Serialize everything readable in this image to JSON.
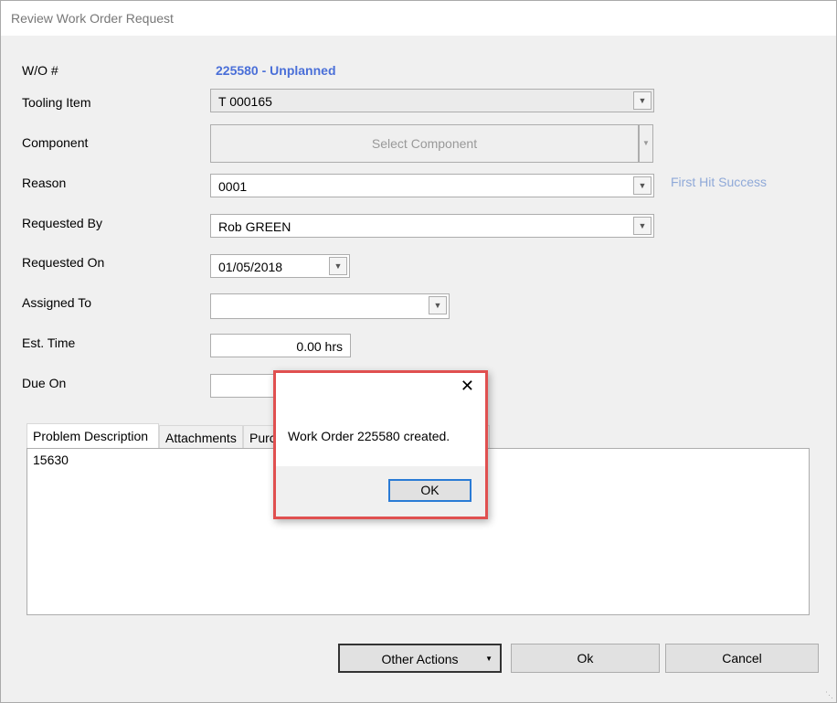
{
  "window": {
    "title": "Review Work Order Request"
  },
  "form": {
    "wo_label": "W/O #",
    "wo_value": "225580 - Unplanned",
    "tooling_label": "Tooling Item",
    "tooling_value": "T 000165",
    "component_label": "Component",
    "component_button": "Select Component",
    "reason_label": "Reason",
    "reason_value": "0001",
    "reason_link": "First Hit Success",
    "requested_by_label": "Requested By",
    "requested_by_value": "Rob GREEN",
    "requested_on_label": "Requested On",
    "requested_on_value": "01/05/2018",
    "assigned_to_label": "Assigned To",
    "assigned_to_value": "",
    "est_time_label": "Est. Time",
    "est_time_value": "0.00 hrs",
    "due_on_label": "Due On",
    "due_on_value": ""
  },
  "tabs": [
    {
      "label": "Problem Description"
    },
    {
      "label": "Attachments"
    },
    {
      "label": "Purc"
    }
  ],
  "problem_description": "15630",
  "buttons": {
    "other_actions": "Other Actions",
    "ok": "Ok",
    "cancel": "Cancel"
  },
  "dialog": {
    "message": "Work Order 225580 created.",
    "ok": "OK"
  },
  "colors": {
    "wo_accent": "#4a6fd8",
    "dialog_border": "#e05050"
  }
}
